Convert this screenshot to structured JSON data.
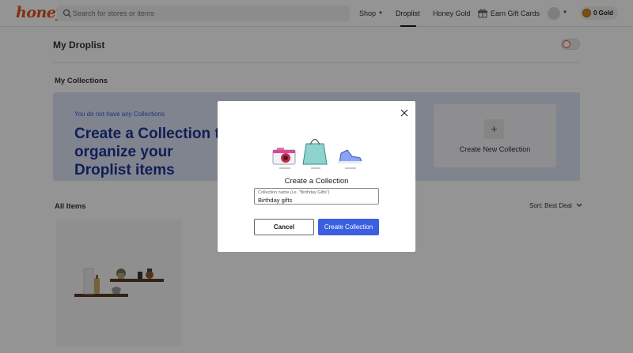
{
  "header": {
    "logo": "honey",
    "search_placeholder": "Search for stores or items",
    "nav": {
      "shop": "Shop",
      "droplist": "Droplist",
      "honey_gold": "Honey Gold",
      "gift_cards": "Earn Gift Cards"
    },
    "gold_balance": "0 Gold"
  },
  "page": {
    "title": "My Droplist",
    "collections_heading": "My Collections",
    "banner_note": "You do not have any Collections",
    "banner_headline": "Create a Collection to organize your Droplist items",
    "new_collection_label": "Create New Collection",
    "all_items_heading": "All Items",
    "sort_label": "Sort: Best Deal"
  },
  "modal": {
    "title": "Create a Collection",
    "field_label": "Collection name (i.e. \"Birthday Gifts\")",
    "field_value": "Birthday gifts",
    "cancel_label": "Cancel",
    "create_label": "Create Collection"
  },
  "colors": {
    "brand": "#e0521f",
    "primary_button": "#3b5fe0",
    "banner_bg": "#dde3f5",
    "banner_text": "#1e3494"
  }
}
